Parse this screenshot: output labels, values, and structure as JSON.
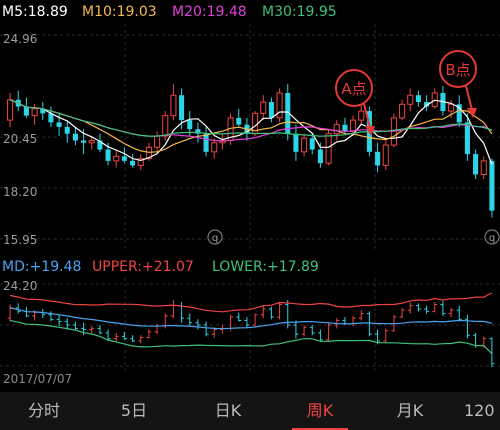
{
  "ma_legend": {
    "ma5": {
      "label": "M5:18.89",
      "color": "#ffffff"
    },
    "ma10": {
      "label": "M10:19.03",
      "color": "#f5b94b"
    },
    "ma20": {
      "label": "M20:19.48",
      "color": "#e040d8"
    },
    "ma30": {
      "label": "M30:19.95",
      "color": "#3ec27a"
    }
  },
  "price_axis": {
    "labels": [
      "24.96",
      "20.45",
      "18.20",
      "15.95"
    ]
  },
  "annotations": {
    "a_point": "A点",
    "b_point": "B点"
  },
  "boll_legend": {
    "md": {
      "label": "MD:+19.48",
      "color": "#4aa3f0"
    },
    "upper": {
      "label": "UPPER:+21.07",
      "color": "#ef4444"
    },
    "lower": {
      "label": "LOWER:+17.89",
      "color": "#3ec27a"
    }
  },
  "boll_axis": {
    "top_label": "24.20"
  },
  "date_label": "2017/07/07",
  "tabs": [
    {
      "label": "分时",
      "active": false
    },
    {
      "label": "5日",
      "active": false
    },
    {
      "label": "日K",
      "active": false
    },
    {
      "label": "周K",
      "active": true
    },
    {
      "label": "月K",
      "active": false
    },
    {
      "label": "120",
      "active": false
    }
  ],
  "colors": {
    "up": "#ef4444",
    "down": "#2bd4e6",
    "background": "#000000",
    "grid": "#2a2a2a"
  },
  "icons": {
    "settings": "q-icon"
  },
  "chart_data": {
    "type": "candlestick",
    "period": "weekly",
    "ylim_main": [
      15.95,
      24.96
    ],
    "ylim_boll": [
      17.0,
      24.2
    ],
    "ohlc": [
      [
        21.2,
        22.4,
        20.9,
        22.1
      ],
      [
        22.1,
        22.5,
        21.6,
        21.8
      ],
      [
        21.8,
        22.2,
        21.3,
        21.4
      ],
      [
        21.4,
        21.9,
        21.0,
        21.7
      ],
      [
        21.7,
        22.0,
        21.2,
        21.5
      ],
      [
        21.5,
        21.8,
        20.9,
        21.1
      ],
      [
        21.1,
        21.5,
        20.5,
        20.9
      ],
      [
        20.9,
        21.2,
        20.2,
        20.6
      ],
      [
        20.6,
        20.9,
        20.1,
        20.3
      ],
      [
        20.3,
        20.8,
        19.7,
        20.2
      ],
      [
        20.2,
        20.5,
        19.9,
        20.3
      ],
      [
        20.3,
        20.6,
        19.8,
        19.9
      ],
      [
        19.9,
        20.2,
        19.2,
        19.4
      ],
      [
        19.4,
        19.9,
        19.1,
        19.6
      ],
      [
        19.6,
        20.0,
        19.3,
        19.4
      ],
      [
        19.4,
        19.7,
        19.1,
        19.2
      ],
      [
        19.2,
        19.7,
        19.0,
        19.5
      ],
      [
        19.5,
        20.2,
        19.4,
        20.0
      ],
      [
        20.0,
        20.7,
        19.8,
        20.5
      ],
      [
        20.5,
        21.6,
        20.3,
        21.4
      ],
      [
        21.4,
        22.8,
        21.2,
        22.3
      ],
      [
        22.3,
        22.6,
        20.8,
        21.2
      ],
      [
        21.2,
        21.6,
        20.5,
        20.8
      ],
      [
        20.8,
        21.1,
        20.2,
        20.6
      ],
      [
        20.6,
        20.9,
        19.6,
        19.8
      ],
      [
        19.8,
        20.4,
        19.5,
        20.2
      ],
      [
        20.2,
        20.6,
        19.9,
        20.3
      ],
      [
        20.3,
        21.5,
        20.1,
        21.3
      ],
      [
        21.3,
        21.7,
        20.9,
        21.0
      ],
      [
        21.0,
        21.3,
        20.3,
        20.6
      ],
      [
        20.6,
        21.6,
        20.5,
        21.5
      ],
      [
        21.5,
        22.3,
        21.2,
        22.0
      ],
      [
        22.0,
        22.2,
        21.1,
        21.3
      ],
      [
        21.3,
        22.6,
        21.1,
        22.4
      ],
      [
        22.4,
        22.8,
        20.3,
        20.6
      ],
      [
        20.6,
        21.0,
        19.4,
        19.8
      ],
      [
        19.8,
        20.6,
        19.6,
        20.4
      ],
      [
        20.4,
        20.6,
        19.7,
        19.9
      ],
      [
        19.9,
        20.2,
        19.1,
        19.3
      ],
      [
        19.3,
        20.8,
        19.2,
        20.6
      ],
      [
        20.6,
        21.2,
        20.3,
        21.0
      ],
      [
        21.0,
        21.3,
        20.6,
        20.7
      ],
      [
        20.7,
        21.4,
        20.5,
        21.2
      ],
      [
        21.2,
        21.9,
        21.0,
        21.6
      ],
      [
        21.6,
        21.8,
        19.6,
        19.8
      ],
      [
        19.8,
        20.2,
        18.9,
        19.2
      ],
      [
        19.2,
        20.3,
        19.0,
        20.1
      ],
      [
        20.1,
        21.5,
        20.0,
        21.3
      ],
      [
        21.3,
        22.1,
        21.2,
        21.9
      ],
      [
        21.9,
        22.6,
        21.6,
        22.3
      ],
      [
        22.3,
        22.5,
        21.8,
        22.0
      ],
      [
        22.0,
        22.3,
        21.6,
        21.8
      ],
      [
        21.8,
        22.6,
        21.7,
        22.4
      ],
      [
        22.4,
        22.7,
        21.4,
        21.6
      ],
      [
        21.6,
        22.1,
        21.3,
        21.9
      ],
      [
        21.9,
        22.3,
        20.9,
        21.1
      ],
      [
        21.1,
        21.5,
        19.4,
        19.7
      ],
      [
        19.7,
        19.9,
        18.6,
        18.8
      ],
      [
        18.8,
        19.6,
        18.6,
        19.4
      ],
      [
        19.4,
        19.5,
        16.9,
        17.2
      ]
    ],
    "series": [
      {
        "name": "M5",
        "color": "#ffffff"
      },
      {
        "name": "M10",
        "color": "#f5b94b"
      },
      {
        "name": "M20",
        "color": "#e040d8"
      },
      {
        "name": "M30",
        "color": "#3ec27a"
      }
    ],
    "boll": [
      {
        "name": "UPPER",
        "color": "#ef4444"
      },
      {
        "name": "MD",
        "color": "#4aa3f0"
      },
      {
        "name": "LOWER",
        "color": "#3ec27a"
      }
    ]
  }
}
